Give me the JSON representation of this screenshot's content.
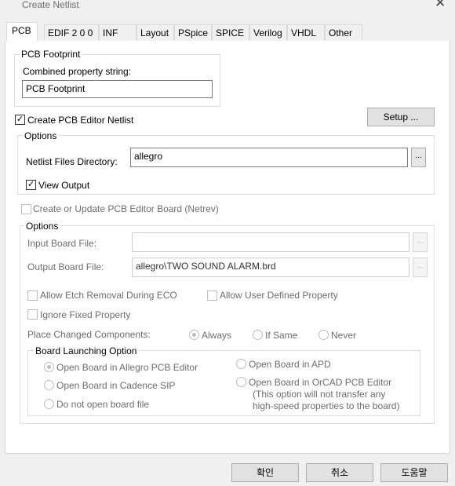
{
  "window": {
    "title": "Create Netlist",
    "close": "✕"
  },
  "tabs": [
    "PCB",
    "EDIF 2 0 0",
    "INF",
    "Layout",
    "PSpice",
    "SPICE",
    "Verilog",
    "VHDL",
    "Other"
  ],
  "pcb_footprint": {
    "legend": "PCB Footprint",
    "label": "Combined property string:",
    "value": "PCB Footprint"
  },
  "create_netlist": {
    "label": "Create PCB Editor Netlist",
    "checked": true,
    "check_glyph": "✓"
  },
  "setup_button": "Setup ...",
  "options1": {
    "legend": "Options",
    "dir_label": "Netlist Files Directory:",
    "dir_value": "allegro",
    "browse": "...",
    "view_output": "View Output",
    "view_output_checked": true
  },
  "netrev": {
    "label": "Create or Update PCB Editor Board (Netrev)",
    "checked": false
  },
  "options2": {
    "legend": "Options",
    "input_board_label": "Input Board File:",
    "input_board_value": "",
    "output_board_label": "Output Board File:",
    "output_board_value": "allegro\\TWO SOUND ALARM.brd",
    "browse": "...",
    "allow_etch": "Allow Etch Removal During ECO",
    "allow_user": "Allow User Defined Property",
    "ignore_fixed": "Ignore Fixed Property",
    "place_changed_label": "Place Changed Components:",
    "place_options": [
      "Always",
      "If Same",
      "Never"
    ],
    "place_selected": "Always"
  },
  "board_launch": {
    "legend": "Board Launching Option",
    "options": [
      "Open Board in Allegro PCB Editor",
      "Open Board in Cadence SIP",
      "Do not open board file",
      "Open Board in APD",
      "Open Board in OrCAD PCB Editor"
    ],
    "selected": "Open Board in Allegro PCB Editor",
    "orcad_note_1": "(This option will not transfer any",
    "orcad_note_2": "high-speed properties to the board)"
  },
  "footer": {
    "ok": "확인",
    "cancel": "취소",
    "help": "도움말"
  }
}
